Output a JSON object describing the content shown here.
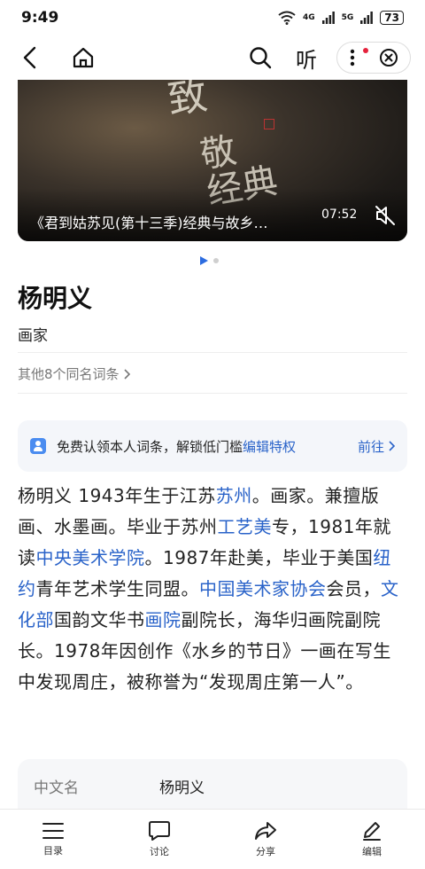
{
  "status": {
    "time": "9:49",
    "net1": "4G",
    "net2": "5G",
    "battery": "73"
  },
  "nav": {
    "listen_label": "听"
  },
  "banner": {
    "caption": "《君到姑苏见(第十三季)经典与故乡…",
    "duration": "07:52",
    "calligraphy_top": "致",
    "calligraphy_mid": "敬",
    "calligraphy_bottom": "经典"
  },
  "entry": {
    "title": "杨明义",
    "subtitle": "画家",
    "others": "其他8个同名词条"
  },
  "claim": {
    "text": "免费认领本人词条，解锁低门槛",
    "link": "编辑特权",
    "action": "前往"
  },
  "summary": {
    "p1": "杨明义 1943年生于江苏",
    "l1": "苏州",
    "p2": "。画家。兼擅版画、水墨画。毕业于苏州",
    "l2": "工艺美",
    "p3": "专，1981年就读",
    "l3": "中央美术学院",
    "p4": "。1987年赴美，毕业于美国",
    "l4": "纽约",
    "p5": "青年艺术学生同盟。",
    "l5": "中国美术家协会",
    "p6": "会员，",
    "l6": "文化部",
    "p7": "国韵文华书",
    "l7": "画院",
    "p8": "副院长，海华归画院副院长。1978年因创作《水乡的节日》一画在写生中发现周庄，被称誉为“发现周庄第一人”。"
  },
  "infobox": {
    "key": "中文名",
    "value": "杨明义"
  },
  "bottom_tabs": [
    {
      "label": "目录"
    },
    {
      "label": "讨论"
    },
    {
      "label": "分享"
    },
    {
      "label": "编辑"
    }
  ]
}
